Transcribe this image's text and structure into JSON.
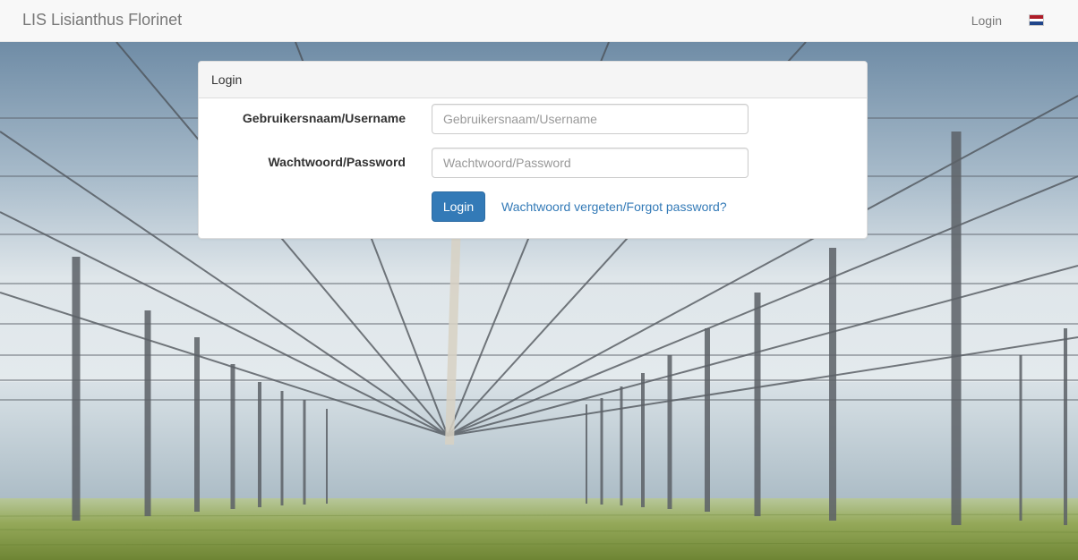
{
  "navbar": {
    "brand": "LIS Lisianthus Florinet",
    "login_link": "Login",
    "language_flag": "dutch-flag-icon",
    "flag_colors": [
      "#ae1c28",
      "#ffffff",
      "#21468b"
    ]
  },
  "background": {
    "description_icon": "greenhouse-background-image"
  },
  "panel": {
    "heading": "Login",
    "username": {
      "label": "Gebruikersnaam/Username",
      "placeholder": "Gebruikersnaam/Username",
      "value": ""
    },
    "password": {
      "label": "Wachtwoord/Password",
      "placeholder": "Wachtwoord/Password",
      "value": ""
    },
    "submit_label": "Login",
    "forgot_label": "Wachtwoord vergeten/Forgot password?"
  },
  "colors": {
    "primary": "#337ab7",
    "link": "#337ab7",
    "navbar_bg": "#f8f8f8"
  }
}
